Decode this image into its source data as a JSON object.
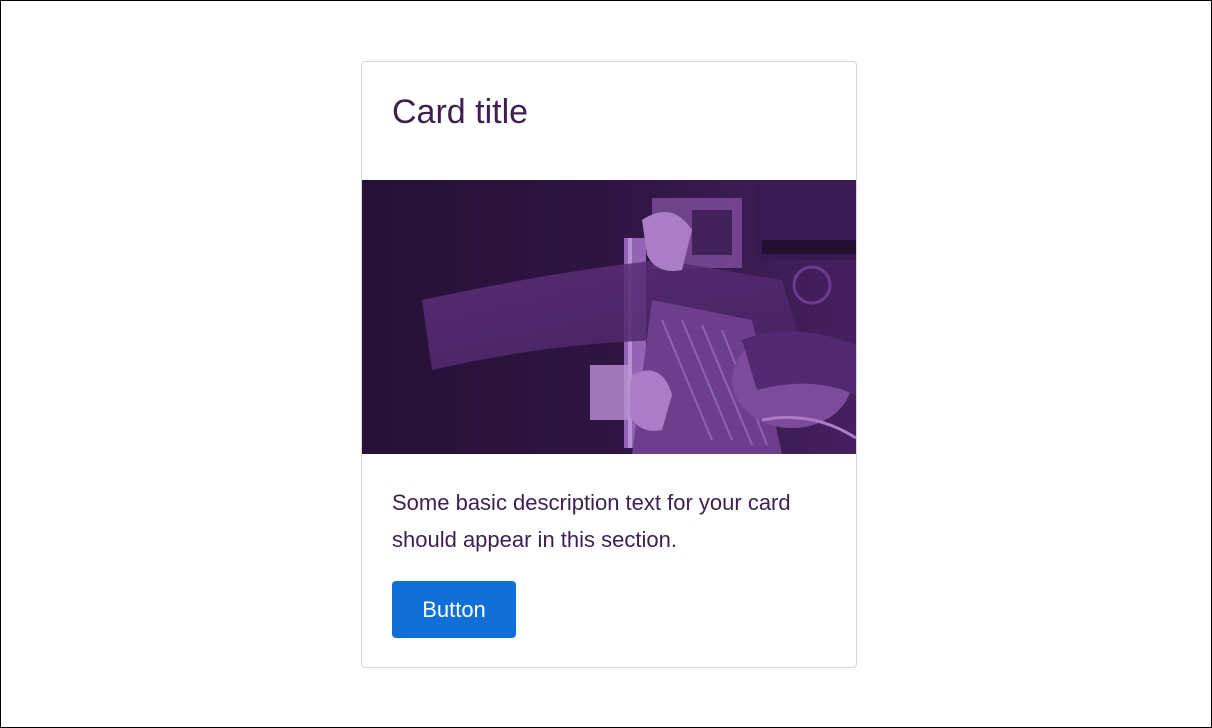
{
  "card": {
    "title": "Card title",
    "description": "Some basic description text for your card should appear in this section.",
    "button_label": "Button",
    "image_subject": "person-reading-book-photo",
    "image_tint": "#7a3c9e"
  },
  "colors": {
    "title_text": "#3d1f52",
    "description_text": "#3d1f52",
    "button_background": "#1170d8",
    "button_text": "#ffffff",
    "card_border": "#d7d7d7"
  }
}
